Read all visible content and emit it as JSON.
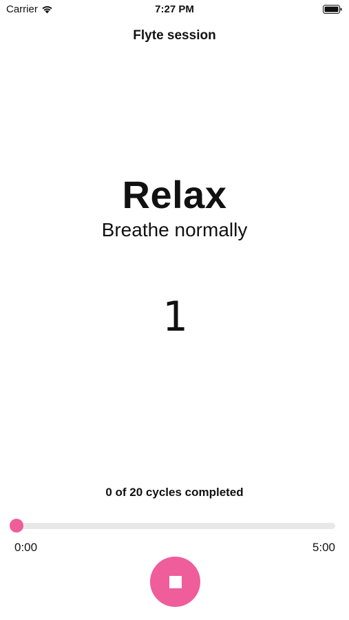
{
  "status_bar": {
    "carrier": "Carrier",
    "time": "7:27 PM",
    "wifi_icon": "wifi-icon",
    "battery_icon": "battery-full-icon"
  },
  "nav": {
    "title": "Flyte session"
  },
  "session": {
    "phase": "Relax",
    "instruction": "Breathe normally",
    "count": "1"
  },
  "progress": {
    "cycles_label": "0 of 20 cycles completed",
    "cycles_done": 0,
    "cycles_total": 20,
    "elapsed": "0:00",
    "total": "5:00",
    "fraction": 0
  },
  "controls": {
    "stop_icon": "stop-icon"
  },
  "colors": {
    "accent": "#ef5d9b",
    "track": "#e8e8e8"
  }
}
